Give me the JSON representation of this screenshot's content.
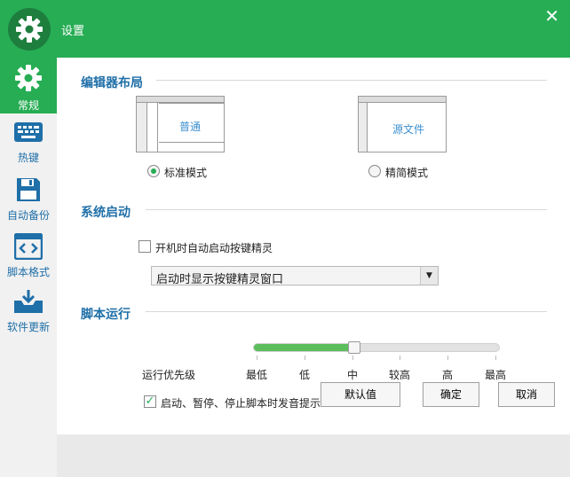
{
  "window": {
    "title": "设置"
  },
  "sidebar": {
    "items": [
      {
        "label": "常规",
        "icon": "gear-icon"
      },
      {
        "label": "热键",
        "icon": "keyboard-icon"
      },
      {
        "label": "自动备份",
        "icon": "floppy-disk-icon"
      },
      {
        "label": "脚本格式",
        "icon": "code-icon"
      },
      {
        "label": "软件更新",
        "icon": "download-tray-icon"
      }
    ],
    "active_index": 0
  },
  "layout_section": {
    "title": "编辑器布局",
    "thumb_standard_text": "普通",
    "thumb_compact_text": "源文件",
    "options": [
      {
        "label": "标准模式",
        "selected": true
      },
      {
        "label": "精简模式",
        "selected": false
      }
    ]
  },
  "startup_section": {
    "title": "系统启动",
    "autostart_label": "开机时自动启动按键精灵",
    "autostart_checked": false,
    "window_mode": {
      "selected": "启动时显示按键精灵窗口"
    }
  },
  "run_section": {
    "title": "脚本运行",
    "priority_label": "运行优先级",
    "priority_levels": [
      "最低",
      "低",
      "中",
      "较高",
      "高",
      "最高"
    ],
    "priority_selected": "中",
    "sound_label": "启动、暂停、停止脚本时发音提示",
    "sound_checked": true
  },
  "footer": {
    "default_label": "默认值",
    "ok_label": "确定",
    "cancel_label": "取消"
  },
  "colors": {
    "accent": "#27ad54",
    "link_blue": "#1f6fa8"
  }
}
